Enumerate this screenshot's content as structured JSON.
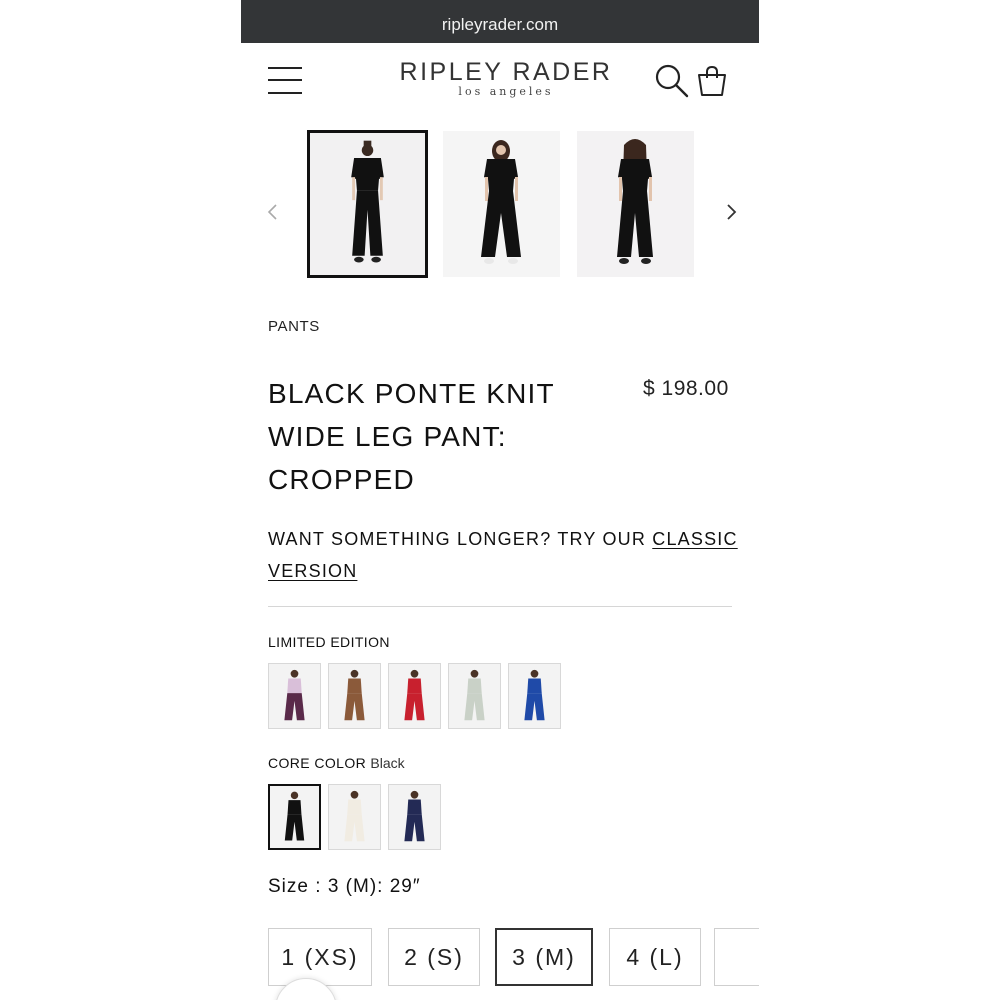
{
  "browser": {
    "url": "ripleyrader.com"
  },
  "header": {
    "logo_main": "RIPLEY RADER",
    "logo_sub": "los angeles"
  },
  "gallery": {
    "images": [
      {
        "name": "front-view",
        "selected": true
      },
      {
        "name": "front-view-alt",
        "selected": false
      },
      {
        "name": "back-view",
        "selected": false
      }
    ]
  },
  "product": {
    "category": "PANTS",
    "title": "BLACK PONTE KNIT WIDE LEG PANT: CROPPED",
    "price": "$ 198.00",
    "promo_bold": "WANT SOMETHING LONGER?",
    "promo_text": " TRY OUR ",
    "promo_link": "CLASSIC VERSION"
  },
  "limited_edition": {
    "label": "LIMITED EDITION",
    "swatches": [
      {
        "top": "#d9bfd9",
        "bottom": "#5a2a4a"
      },
      {
        "top": "#8b5a3a",
        "bottom": "#8b5a3a"
      },
      {
        "top": "#c8202e",
        "bottom": "#c8202e"
      },
      {
        "top": "#c9d1c7",
        "bottom": "#c9d1c7"
      },
      {
        "top": "#1f4aa8",
        "bottom": "#1f4aa8"
      }
    ]
  },
  "core_color": {
    "label": "CORE COLOR",
    "value": "Black",
    "swatches": [
      {
        "top": "#111111",
        "bottom": "#111111",
        "selected": true
      },
      {
        "top": "#f1ece2",
        "bottom": "#f1ece2",
        "selected": false
      },
      {
        "top": "#232a55",
        "bottom": "#232a55",
        "selected": false
      }
    ]
  },
  "size": {
    "label": "Size",
    "separator": " : ",
    "value": "3 (M): 29″",
    "options": [
      "1 (XS)",
      "2 (S)",
      "3 (M)",
      "4 (L)"
    ],
    "selected": "3 (M)"
  },
  "colors": {
    "url_bar": "#333537",
    "text": "#111111",
    "selected_border": "#111111"
  }
}
